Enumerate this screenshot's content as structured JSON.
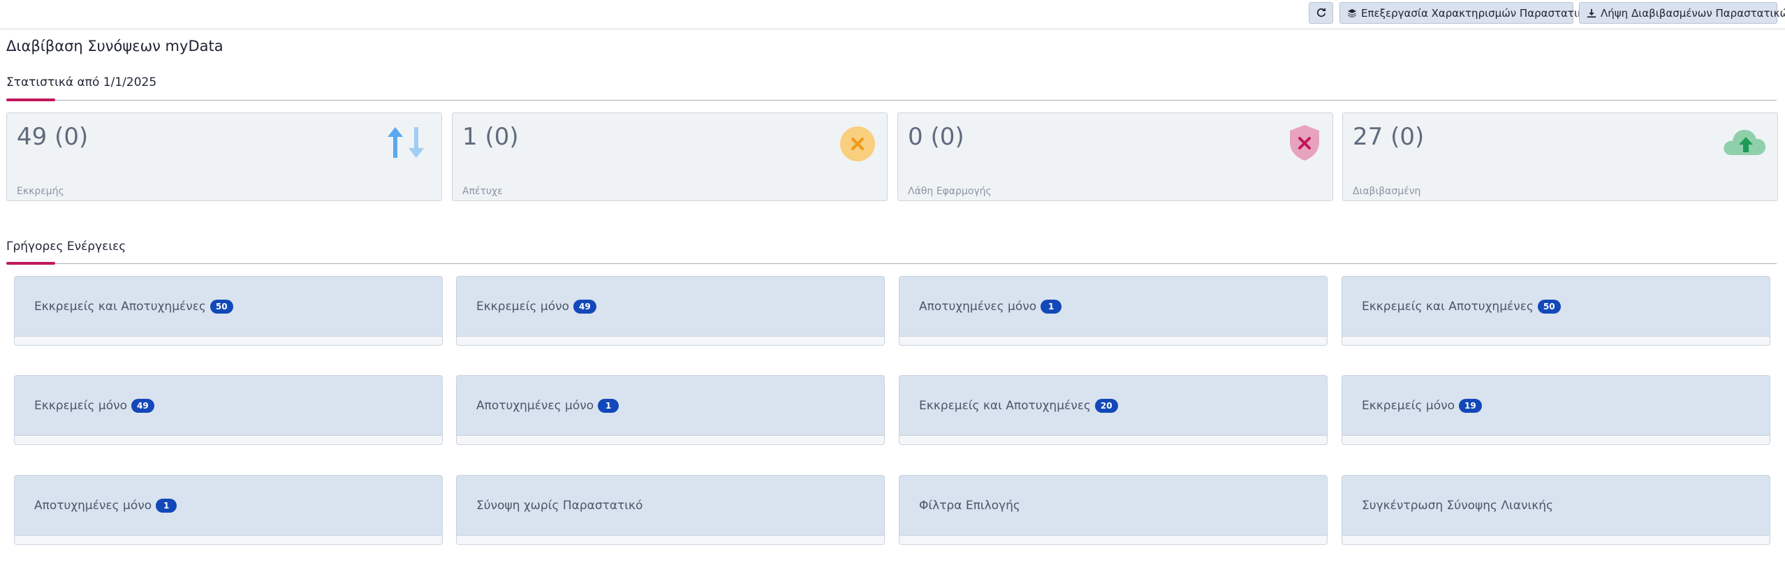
{
  "toolbar": {
    "refresh_icon": "refresh-icon",
    "edit_label": "Επεξεργασία Χαρακτηρισμών Παραστατικών",
    "edit_icon": "layers-icon",
    "download_label": "Λήψη Διαβιβασμένων Παραστατικών",
    "download_icon": "download-icon"
  },
  "page": {
    "title": "Διαβίβαση Συνόψεων myData"
  },
  "stats_section": {
    "title": "Στατιστικά από 1/1/2025",
    "cards": [
      {
        "value": "49 (0)",
        "label": "Εκκρεμής",
        "icon": "arrows-up-down-icon",
        "color": "#5aa8f0"
      },
      {
        "value": "1 (0)",
        "label": "Απέτυχε",
        "icon": "x-circle-icon",
        "color": "#f5c56a"
      },
      {
        "value": "0 (0)",
        "label": "Λάθη Εφαρμογής",
        "icon": "shield-x-icon",
        "color": "#e58aa8"
      },
      {
        "value": "27 (0)",
        "label": "Διαβιβασμένη",
        "icon": "cloud-upload-icon",
        "color": "#79c99a"
      }
    ]
  },
  "actions_section": {
    "title": "Γρήγορες Ενέργειες",
    "accent_color": "#c0185c",
    "badge_color": "#1248b8",
    "items": [
      {
        "label": "Εκκρεμείς και Αποτυχημένες",
        "count": "50"
      },
      {
        "label": "Εκκρεμείς μόνο",
        "count": "49"
      },
      {
        "label": "Αποτυχημένες μόνο",
        "count": "1"
      },
      {
        "label": "Εκκρεμείς και Αποτυχημένες",
        "count": "50"
      },
      {
        "label": "Εκκρεμείς μόνο",
        "count": "49"
      },
      {
        "label": "Αποτυχημένες μόνο",
        "count": "1"
      },
      {
        "label": "Εκκρεμείς και Αποτυχημένες",
        "count": "20"
      },
      {
        "label": "Εκκρεμείς μόνο",
        "count": "19"
      },
      {
        "label": "Αποτυχημένες μόνο",
        "count": "1"
      },
      {
        "label": "Σύνοψη χωρίς Παραστατικό"
      },
      {
        "label": "Φίλτρα Επιλογής"
      },
      {
        "label": "Συγκέντρωση Σύνοψης Λιανικής"
      }
    ]
  }
}
